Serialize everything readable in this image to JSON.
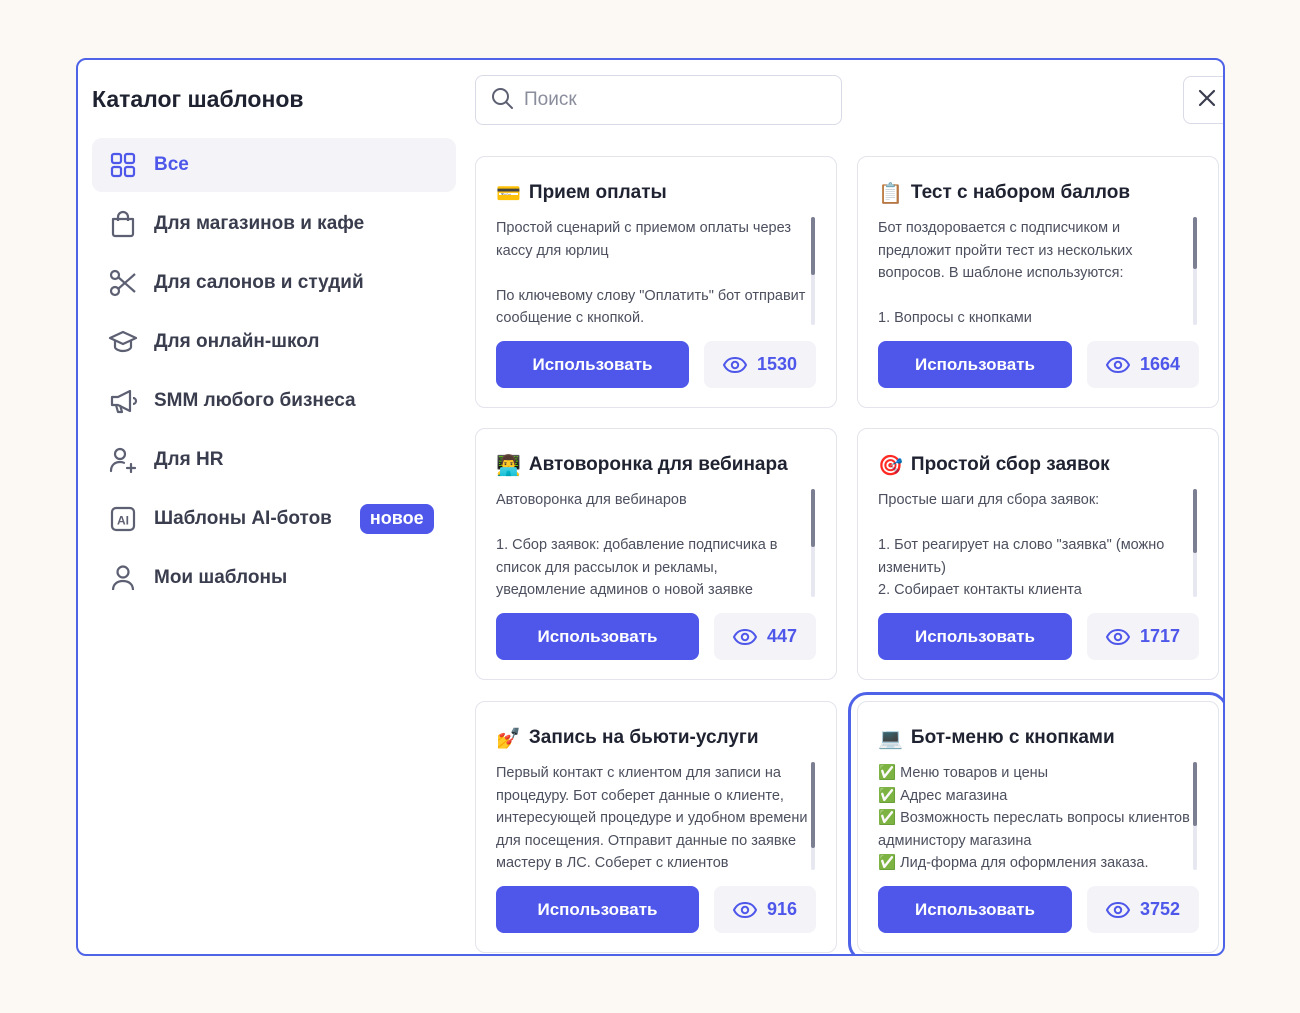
{
  "sidebar": {
    "title": "Каталог шаблонов",
    "items": [
      {
        "label": "Все",
        "icon": "grid-icon"
      },
      {
        "label": "Для магазинов и кафе",
        "icon": "shopping-bag-icon"
      },
      {
        "label": "Для салонов и студий",
        "icon": "scissors-icon"
      },
      {
        "label": "Для онлайн-школ",
        "icon": "graduation-cap-icon"
      },
      {
        "label": "SMM любого бизнеса",
        "icon": "megaphone-icon"
      },
      {
        "label": "Для HR",
        "icon": "user-plus-icon"
      },
      {
        "label": "Шаблоны AI-ботов",
        "icon": "ai-icon",
        "badge": "новое"
      },
      {
        "label": "Мои шаблоны",
        "icon": "user-icon"
      }
    ]
  },
  "search": {
    "placeholder": "Поиск"
  },
  "colors": {
    "accent": "#4e57ea",
    "border": "#4e63e8",
    "background": "#fcf9f4"
  },
  "cards": [
    {
      "emoji": "💳",
      "title": "Прием оплаты",
      "desc": "Простой сценарий с приемом оплаты через кассу для юрлиц\n\nПо ключевому слову \"Оплатить\" бот отправит сообщение с кнопкой.",
      "button": "Использовать",
      "views": "1530"
    },
    {
      "emoji": "📋",
      "title": "Тест с набором баллов",
      "desc": "Бот поздоровается с подписчиком и предложит пройти тест из нескольких вопросов. В шаблоне используются:\n\n1. Вопросы с кнопками",
      "button": "Использовать",
      "views": "1664"
    },
    {
      "emoji": "👨‍💻",
      "title": "Автоворонка для вебинара",
      "desc": "Автоворонка для вебинаров\n\n1. Сбор заявок: добавление подписчика в список для рассылок и рекламы, уведомление админов о новой заявке",
      "button": "Использовать",
      "views": "447"
    },
    {
      "emoji": "🎯",
      "title": "Простой сбор заявок",
      "desc": "Простые шаги для сбора заявок:\n\n1. Бот реагирует на слово \"заявка\" (можно изменить)\n2. Собирает контакты клиента",
      "button": "Использовать",
      "views": "1717"
    },
    {
      "emoji": "💅",
      "title": "Запись на бьюти-услуги",
      "desc": "Первый контакт с клиентом для записи на процедуру. Бот соберет данные о клиенте, интересующей процедуре и удобном времени для посещения. Отправит данные по заявке мастеру в ЛС. Соберет с клиентов",
      "button": "Использовать",
      "views": "916"
    },
    {
      "emoji": "💻",
      "title": "Бот-меню с кнопками",
      "desc": "✅ Меню товаров и цены\n✅ Адрес магазина\n✅ Возможность переслать вопросы клиентов администору магазина\n✅ Лид-форма для оформления заказа.",
      "button": "Использовать",
      "views": "3752"
    }
  ]
}
